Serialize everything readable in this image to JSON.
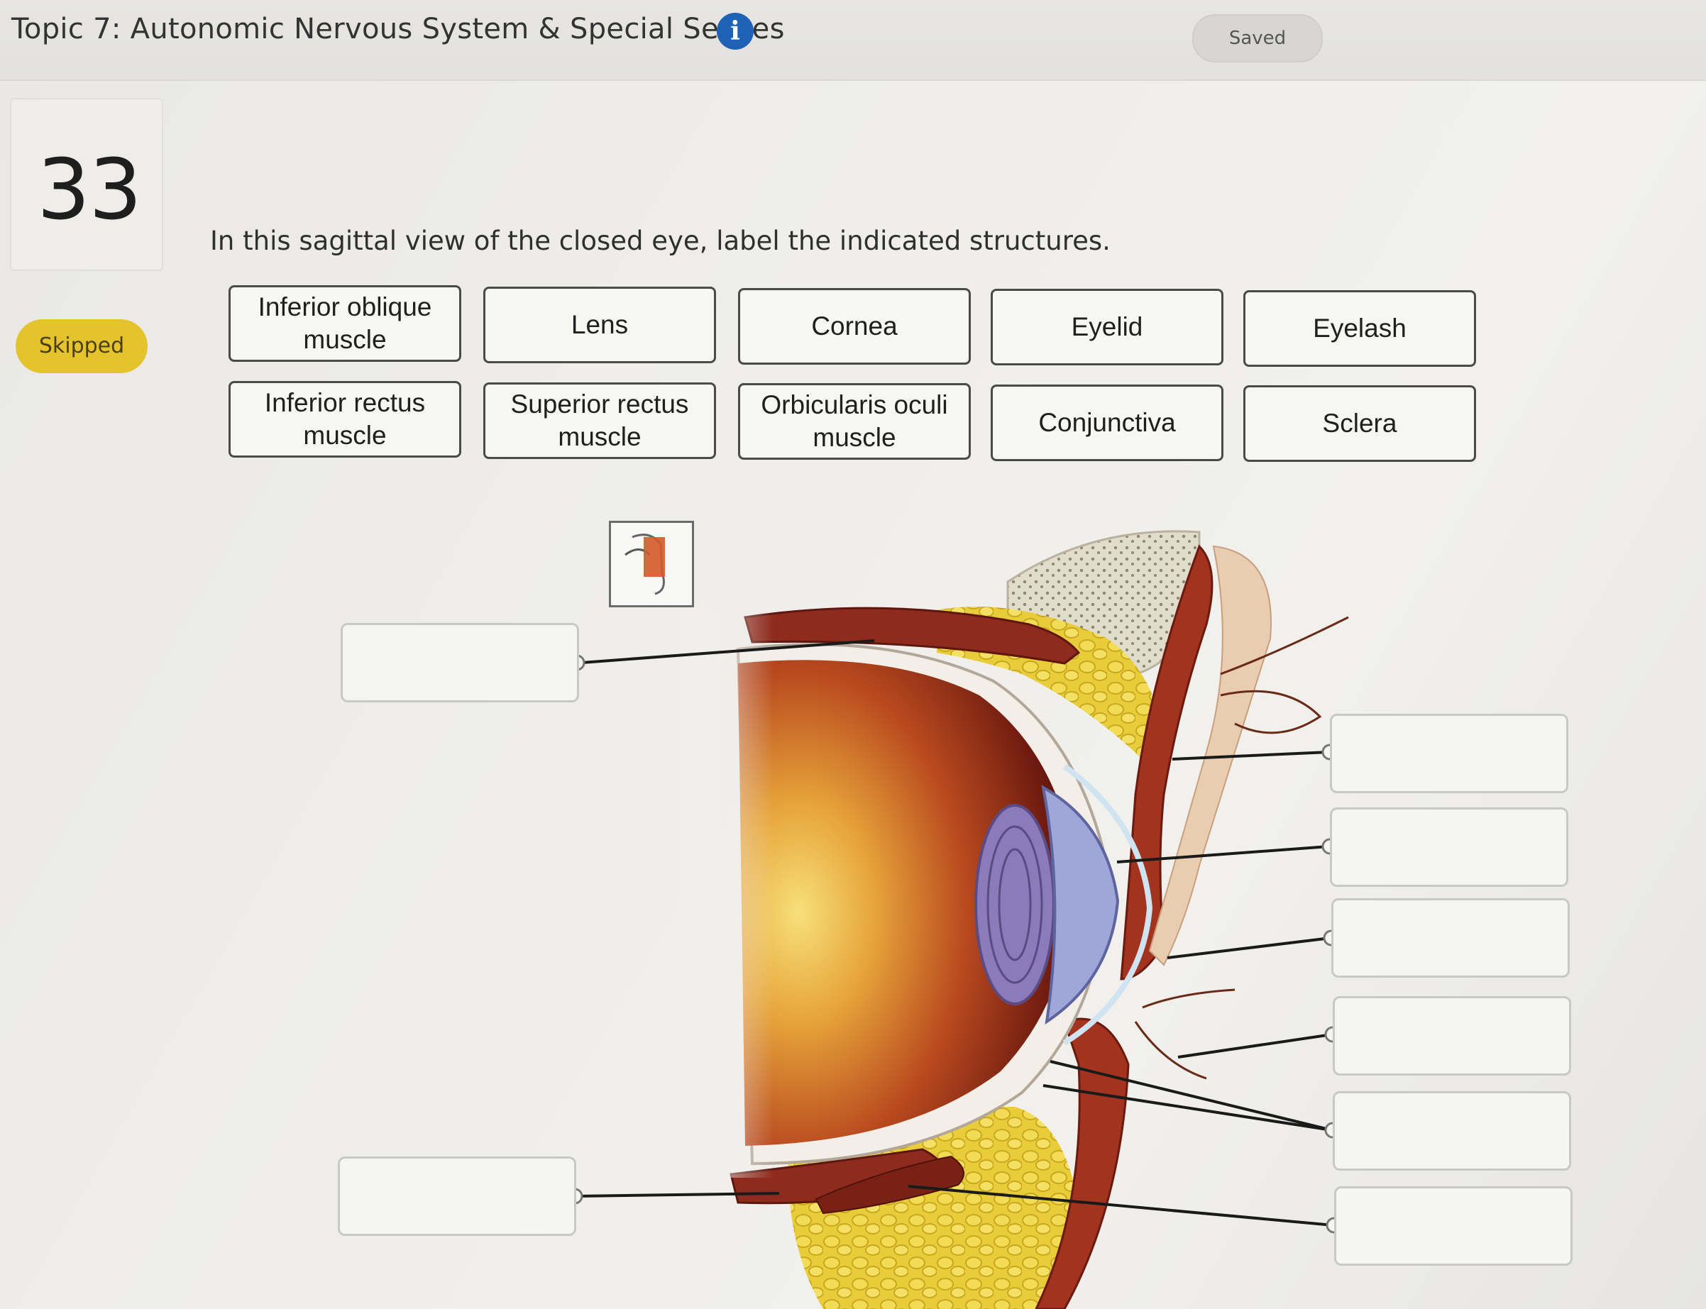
{
  "header": {
    "title": "Topic 7: Autonomic Nervous System & Special Senses",
    "info_icon": "info-icon",
    "saved_label": "Saved"
  },
  "question": {
    "number": "33",
    "status": "Skipped",
    "prompt": "In this sagittal view of the closed eye, label the indicated structures."
  },
  "terms": [
    "Inferior oblique muscle",
    "Lens",
    "Cornea",
    "Eyelid",
    "Eyelash",
    "Inferior rectus muscle",
    "Superior rectus muscle",
    "Orbicularis oculi muscle",
    "Conjunctiva",
    "Sclera"
  ],
  "drop_targets": {
    "left": [
      "",
      ""
    ],
    "right": [
      "",
      "",
      "",
      "",
      "",
      ""
    ]
  },
  "colors": {
    "accent_blue": "#1e62b5",
    "skipped_yellow": "#e4c32c",
    "muscle_red": "#8e2b1e",
    "fat_yellow": "#e8cc3a",
    "lens_purple": "#8b7bbb"
  }
}
